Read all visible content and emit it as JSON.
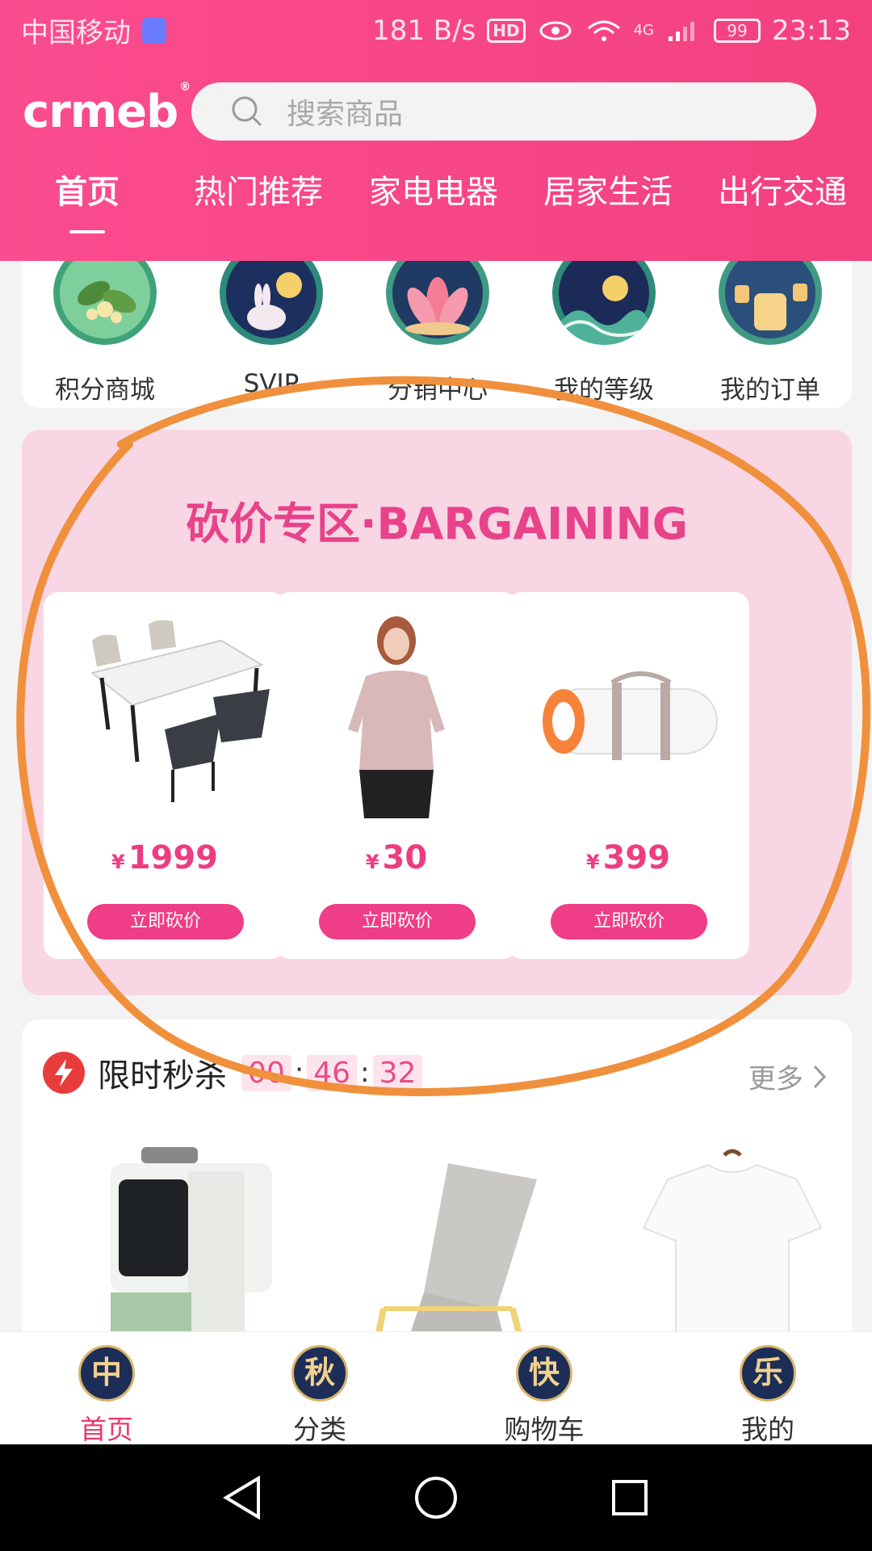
{
  "status_bar": {
    "carrier": "中国移动",
    "net_speed": "181 B/s",
    "hd": "HD",
    "network": "4G",
    "battery": "99",
    "time": "23:13"
  },
  "header": {
    "logo": "crmeb",
    "logo_mark": "®",
    "search_placeholder": "搜索商品",
    "tabs": [
      "首页",
      "热门推荐",
      "家电电器",
      "居家生活",
      "出行交通"
    ]
  },
  "menu": {
    "items": [
      {
        "label": "积分商城",
        "icon": "osmanthus-icon"
      },
      {
        "label": "SVIP",
        "icon": "rabbit-moon-icon"
      },
      {
        "label": "分销中心",
        "icon": "lotus-icon"
      },
      {
        "label": "我的等级",
        "icon": "wave-moon-icon"
      },
      {
        "label": "我的订单",
        "icon": "lantern-icon"
      }
    ]
  },
  "bargain": {
    "title": "砍价专区·BARGAINING",
    "currency": "¥",
    "items": [
      {
        "price": "1999",
        "button": "立即砍价",
        "image": "dining-table-set"
      },
      {
        "price": "30",
        "button": "立即砍价",
        "image": "woman-sweater"
      },
      {
        "price": "399",
        "button": "立即砍价",
        "image": "rolled-mattress"
      }
    ]
  },
  "flash_sale": {
    "title": "限时秒杀",
    "hours": "00",
    "minutes": "46",
    "seconds": "32",
    "more": "更多",
    "products": [
      "soymilk-maker",
      "rocking-chair",
      "white-tshirts"
    ]
  },
  "bottom_nav": {
    "items": [
      {
        "label": "首页",
        "glyph": "中"
      },
      {
        "label": "分类",
        "glyph": "秋"
      },
      {
        "label": "购物车",
        "glyph": "快"
      },
      {
        "label": "我的",
        "glyph": "乐"
      }
    ]
  },
  "colors": {
    "brand": "#f3417f",
    "accent": "#ef3d87",
    "annotation": "#f0903c"
  }
}
